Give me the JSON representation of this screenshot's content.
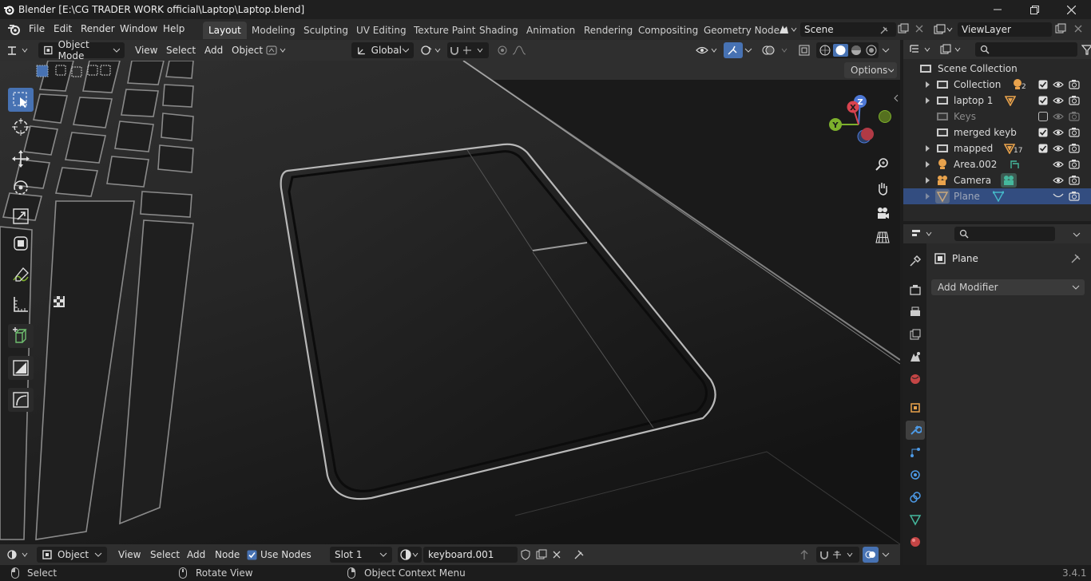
{
  "titlebar": {
    "title": "Blender [E:\\CG TRADER WORK official\\Laptop\\Laptop.blend]"
  },
  "menus": [
    "File",
    "Edit",
    "Render",
    "Window",
    "Help"
  ],
  "workspaces": [
    "Layout",
    "Modeling",
    "Sculpting",
    "UV Editing",
    "Texture Paint",
    "Shading",
    "Animation",
    "Rendering",
    "Compositing",
    "Geometry Node"
  ],
  "scene": {
    "name": "Scene"
  },
  "viewlayer": {
    "name": "ViewLayer"
  },
  "viewport_header": {
    "mode": "Object Mode",
    "view": "View",
    "select": "Select",
    "add": "Add",
    "object": "Object",
    "orientation": "Global",
    "options": "Options"
  },
  "gizmo": {
    "x": "X",
    "y": "Y",
    "z": "Z"
  },
  "outliner": {
    "root": "Scene Collection",
    "items": [
      {
        "name": "Collection",
        "badge": "2"
      },
      {
        "name": "laptop 1",
        "badge": ""
      },
      {
        "name": "Keys",
        "badge": ""
      },
      {
        "name": "merged keyb",
        "badge": ""
      },
      {
        "name": "mapped",
        "badge": "17"
      },
      {
        "name": "Area.002",
        "badge": ""
      },
      {
        "name": "Camera",
        "badge": ""
      },
      {
        "name": "Plane",
        "badge": ""
      }
    ]
  },
  "properties": {
    "object_name": "Plane",
    "add_modifier": "Add Modifier"
  },
  "bottom_header": {
    "editor": "Object",
    "view": "View",
    "select": "Select",
    "add": "Add",
    "node": "Node",
    "use_nodes": "Use Nodes",
    "slot": "Slot 1",
    "material": "keyboard.001"
  },
  "statusbar": {
    "select": "Select",
    "rotate": "Rotate View",
    "context": "Object Context Menu",
    "version": "3.4.1"
  },
  "colors": {
    "accent": "#4772b3",
    "selected_row": "#334d80",
    "axis_x": "#d9434f",
    "axis_y": "#7db02c",
    "axis_z": "#4d78d6"
  }
}
